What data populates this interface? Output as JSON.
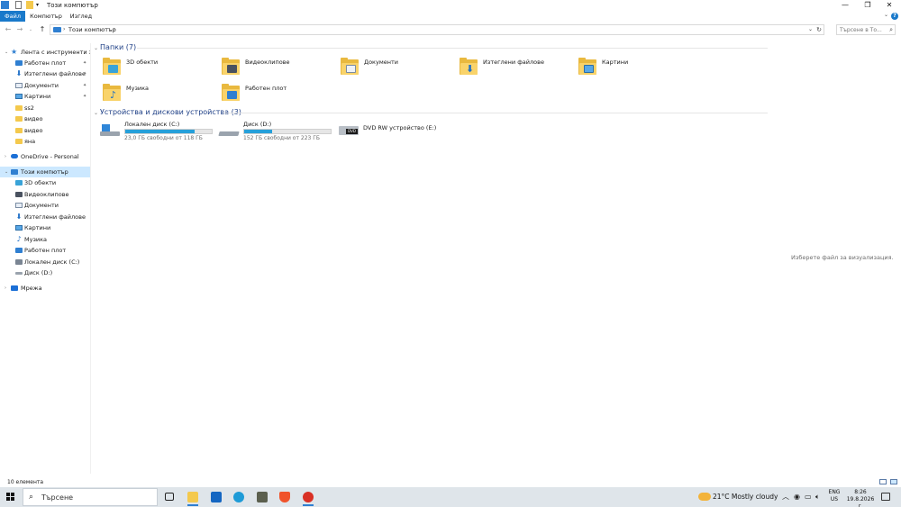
{
  "window": {
    "title": "Този компютър",
    "controls": {
      "minimize": "—",
      "maximize": "❐",
      "close": "✕"
    }
  },
  "ribbon": {
    "tabs": [
      "Файл",
      "Компютър",
      "Изглед"
    ],
    "help": "?"
  },
  "address": {
    "crumb": "Този компютър",
    "search_placeholder": "Търсене в То..."
  },
  "nav": {
    "quick_access": "Лента с инструменти за бързо...",
    "pinned": [
      {
        "label": "Работен плот",
        "icon": "desktop-icon"
      },
      {
        "label": "Изтеглени файлове",
        "icon": "downloads-icon"
      },
      {
        "label": "Документи",
        "icon": "documents-icon"
      },
      {
        "label": "Картини",
        "icon": "pictures-icon"
      }
    ],
    "recent": [
      "ss2",
      "видео",
      "видео",
      "яна"
    ],
    "onedrive": "OneDrive - Personal",
    "this_pc": "Този компютър",
    "this_pc_children": [
      {
        "label": "3D обекти",
        "icon": "3d-objects-icon"
      },
      {
        "label": "Видеоклипове",
        "icon": "videos-icon"
      },
      {
        "label": "Документи",
        "icon": "documents-icon"
      },
      {
        "label": "Изтеглени файлове",
        "icon": "downloads-icon"
      },
      {
        "label": "Картини",
        "icon": "pictures-icon"
      },
      {
        "label": "Музика",
        "icon": "music-icon"
      },
      {
        "label": "Работен плот",
        "icon": "desktop-icon"
      },
      {
        "label": "Локален диск (C:)",
        "icon": "drive-c-icon"
      },
      {
        "label": "Диск (D:)",
        "icon": "drive-d-icon"
      }
    ],
    "network": "Мрежа"
  },
  "folders": {
    "header": "Папки (7)",
    "items": [
      {
        "name": "3D обекти",
        "icon": "3d-objects-folder-icon"
      },
      {
        "name": "Видеоклипове",
        "icon": "videos-folder-icon"
      },
      {
        "name": "Документи",
        "icon": "documents-folder-icon"
      },
      {
        "name": "Изтеглени файлове",
        "icon": "downloads-folder-icon"
      },
      {
        "name": "Картини",
        "icon": "pictures-folder-icon"
      },
      {
        "name": "Музика",
        "icon": "music-folder-icon"
      },
      {
        "name": "Работен плот",
        "icon": "desktop-folder-icon"
      }
    ]
  },
  "devices": {
    "header": "Устройства и дискови устройства (3)",
    "items": [
      {
        "name": "Локален диск (C:)",
        "capacity": "23,0 ГБ свободни от 118 ГБ",
        "used_fraction": 0.805,
        "icon": "windows-drive-icon"
      },
      {
        "name": "Диск (D:)",
        "capacity": "152 ГБ свободни от 223 ГБ",
        "used_fraction": 0.318,
        "icon": "hard-drive-icon"
      },
      {
        "name": "DVD RW устройство (E:)",
        "icon": "dvd-drive-icon"
      }
    ]
  },
  "preview": {
    "message": "Изберете файл за визуализация."
  },
  "status": {
    "count": "10 елемента"
  },
  "taskbar": {
    "search_placeholder": "Търсене",
    "weather": "21°C  Mostly cloudy",
    "lang_line1": "ENG",
    "lang_line2": "US",
    "time": "8:26",
    "date": "19.8.2026 г."
  },
  "colors": {
    "accent": "#1979ca",
    "selection": "#cce8ff",
    "drive_fill": "#26a0da",
    "group_header": "#1e3f86"
  }
}
